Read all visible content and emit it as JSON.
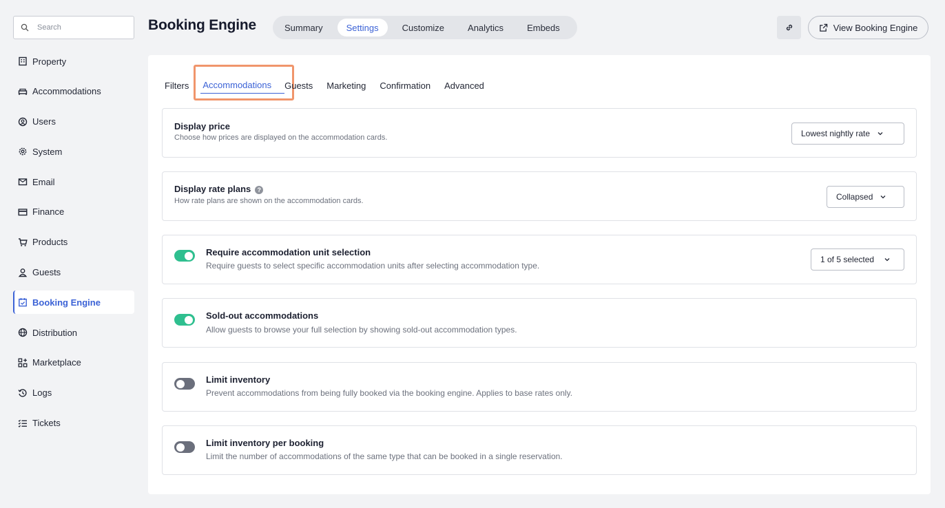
{
  "search": {
    "placeholder": "Search"
  },
  "sidebar": {
    "items": [
      {
        "label": "Property",
        "icon": "building-icon"
      },
      {
        "label": "Accommodations",
        "icon": "bed-icon"
      },
      {
        "label": "Users",
        "icon": "user-circle-icon"
      },
      {
        "label": "System",
        "icon": "gear-icon"
      },
      {
        "label": "Email",
        "icon": "envelope-icon"
      },
      {
        "label": "Finance",
        "icon": "credit-card-icon"
      },
      {
        "label": "Products",
        "icon": "cart-icon"
      },
      {
        "label": "Guests",
        "icon": "person-icon"
      },
      {
        "label": "Booking Engine",
        "icon": "calendar-check-icon",
        "active": true
      },
      {
        "label": "Distribution",
        "icon": "globe-icon"
      },
      {
        "label": "Marketplace",
        "icon": "grid-plus-icon"
      },
      {
        "label": "Logs",
        "icon": "history-icon"
      },
      {
        "label": "Tickets",
        "icon": "list-check-icon"
      }
    ]
  },
  "header": {
    "title": "Booking Engine",
    "tabs": [
      "Summary",
      "Settings",
      "Customize",
      "Analytics",
      "Embeds"
    ],
    "active_tab": "Settings",
    "view_button": "View Booking Engine"
  },
  "sub_tabs": {
    "items": [
      "Filters",
      "Accommodations",
      "Guests",
      "Marketing",
      "Confirmation",
      "Advanced"
    ],
    "active": "Accommodations"
  },
  "settings": {
    "display_price": {
      "title": "Display price",
      "description": "Choose how prices are displayed on the accommodation cards.",
      "value": "Lowest nightly rate"
    },
    "display_rate_plans": {
      "title": "Display rate plans",
      "description": "How rate plans are shown on the accommodation cards.",
      "value": "Collapsed",
      "help": "?"
    },
    "unit_selection": {
      "title": "Require accommodation unit selection",
      "description": "Require guests to select specific accommodation units after selecting accommodation type.",
      "value": "1 of 5 selected",
      "enabled": true
    },
    "sold_out": {
      "title": "Sold-out accommodations",
      "description": "Allow guests to browse your full selection by showing sold-out accommodation types.",
      "enabled": true
    },
    "limit_inventory": {
      "title": "Limit inventory",
      "description": "Prevent accommodations from being fully booked via the booking engine. Applies to base rates only.",
      "enabled": false
    },
    "limit_per_booking": {
      "title": "Limit inventory per booking",
      "description": "Limit the number of accommodations of the same type that can be booked in a single reservation.",
      "enabled": false
    }
  },
  "colors": {
    "accent": "#3b62d6",
    "toggle_on": "#2fbf8f",
    "toggle_off": "#6b6f7c",
    "highlight": "#f0956b"
  }
}
